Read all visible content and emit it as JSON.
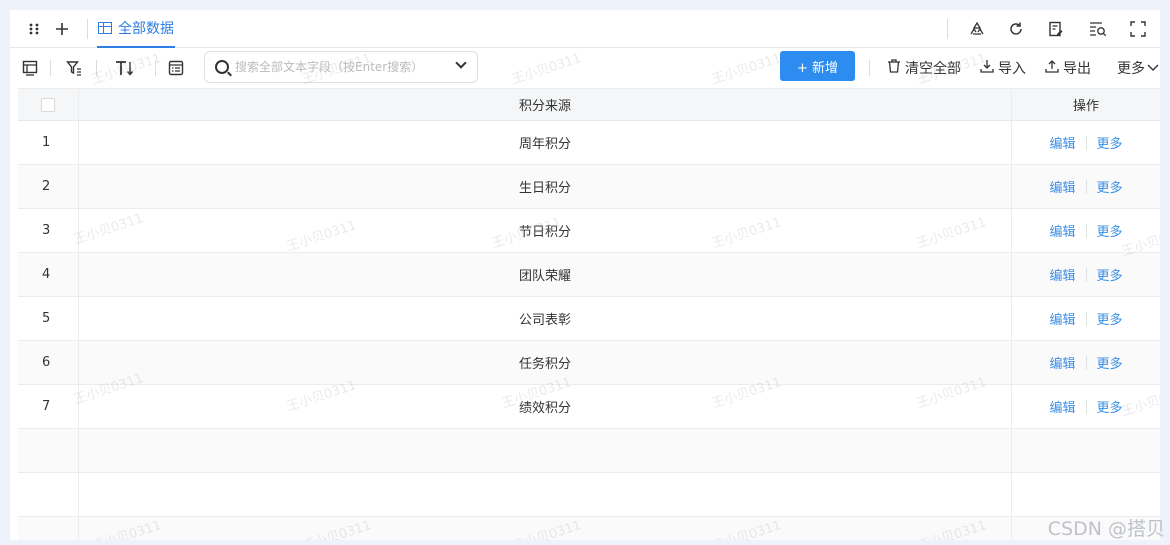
{
  "tabs": {
    "active_label": "全部数据"
  },
  "search": {
    "placeholder": "搜索全部文本字段（按Enter搜索）"
  },
  "toolbar": {
    "new_label": "+ 新增",
    "clear_all_label": "清空全部",
    "import_label": "导入",
    "export_label": "导出",
    "more_label": "更多"
  },
  "table": {
    "columns": {
      "source": "积分来源",
      "actions": "操作"
    },
    "rows": [
      {
        "index": "1",
        "source": "周年积分"
      },
      {
        "index": "2",
        "source": "生日积分"
      },
      {
        "index": "3",
        "source": "节日积分"
      },
      {
        "index": "4",
        "source": "团队荣耀"
      },
      {
        "index": "5",
        "source": "公司表彰"
      },
      {
        "index": "6",
        "source": "任务积分"
      },
      {
        "index": "7",
        "source": "绩效积分"
      }
    ],
    "row_actions": {
      "edit": "编辑",
      "more": "更多"
    }
  },
  "watermark_text": "王小贝0311",
  "credit": "CSDN @搭贝",
  "icons": [
    "drag-handle-icon",
    "add-icon",
    "table-icon",
    "recycle-icon",
    "refresh-icon",
    "edit-log-icon",
    "search-list-icon",
    "fullscreen-icon",
    "layout-icon",
    "filter-icon",
    "text-size-icon",
    "form-icon",
    "search-icon",
    "chevron-down-icon",
    "trash-icon",
    "import-icon",
    "export-icon"
  ],
  "colors": {
    "accent": "#2d8cf0",
    "link": "#3b8fe6",
    "background": "#eef3fb"
  }
}
